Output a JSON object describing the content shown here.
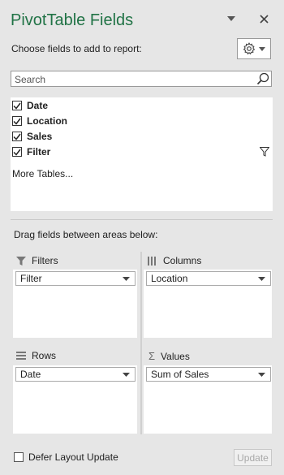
{
  "header": {
    "title": "PivotTable Fields"
  },
  "field_section": {
    "choose_label": "Choose fields to add to report:",
    "search_placeholder": "Search",
    "fields": [
      {
        "label": "Date",
        "checked": true,
        "filtered": false
      },
      {
        "label": "Location",
        "checked": true,
        "filtered": false
      },
      {
        "label": "Sales",
        "checked": true,
        "filtered": false
      },
      {
        "label": "Filter",
        "checked": true,
        "filtered": true
      }
    ],
    "more_tables": "More Tables..."
  },
  "areas": {
    "drag_label": "Drag fields between areas below:",
    "filters": {
      "title": "Filters",
      "items": [
        "Filter"
      ]
    },
    "columns": {
      "title": "Columns",
      "items": [
        "Location"
      ]
    },
    "rows": {
      "title": "Rows",
      "items": [
        "Date"
      ]
    },
    "values": {
      "title": "Values",
      "items": [
        "Sum of Sales"
      ]
    }
  },
  "footer": {
    "defer_label": "Defer Layout Update",
    "update_label": "Update"
  },
  "colors": {
    "title_green": "#217346",
    "panel_bg": "#e6e6e6"
  }
}
